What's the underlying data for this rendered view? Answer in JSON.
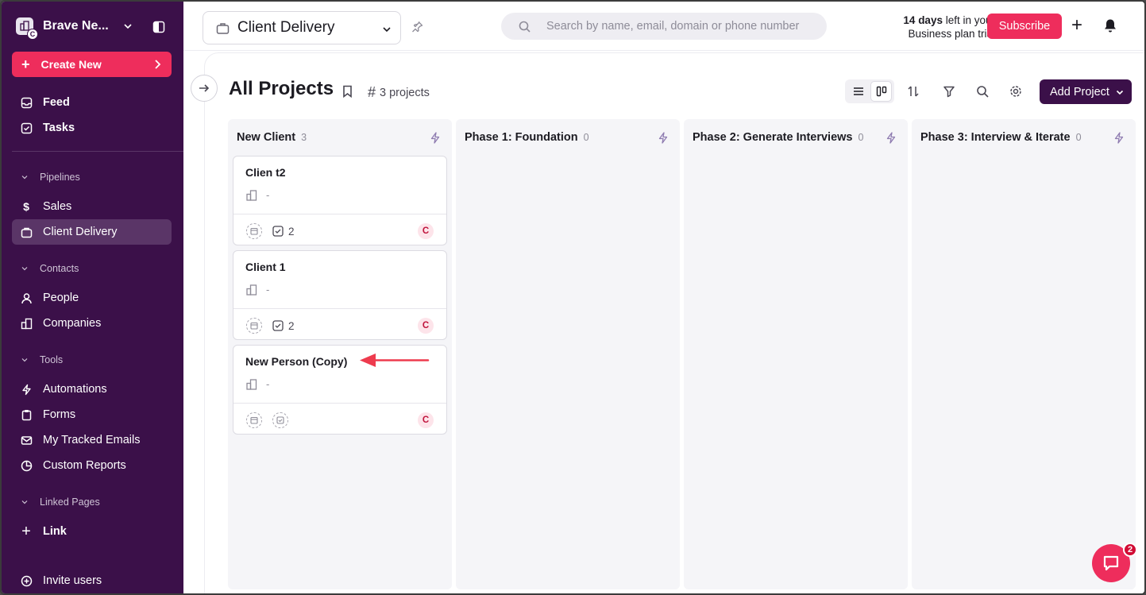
{
  "sidebar": {
    "workspace_name": "Brave Ne...",
    "workspace_badge": "C",
    "create_label": "Create New",
    "feed": "Feed",
    "tasks": "Tasks",
    "pipelines_label": "Pipelines",
    "sales": "Sales",
    "client_delivery": "Client Delivery",
    "contacts_label": "Contacts",
    "people": "People",
    "companies": "Companies",
    "tools_label": "Tools",
    "automations": "Automations",
    "forms": "Forms",
    "tracked_emails": "My Tracked Emails",
    "custom_reports": "Custom Reports",
    "linked_pages_label": "Linked Pages",
    "link": "Link",
    "invite": "Invite users"
  },
  "topbar": {
    "pipeline": "Client Delivery",
    "search_placeholder": "Search by name, email, domain or phone number",
    "trial_days": "14 days",
    "trial_rest": " left in your",
    "trial_line2": "Business plan trial",
    "subscribe": "Subscribe"
  },
  "page": {
    "title": "All Projects",
    "count": "3 projects",
    "add_project": "Add Project"
  },
  "columns": [
    {
      "name": "New Client",
      "count": "3"
    },
    {
      "name": "Phase 1: Foundation",
      "count": "0"
    },
    {
      "name": "Phase 2: Generate Interviews",
      "count": "0"
    },
    {
      "name": "Phase 3: Interview & Iterate",
      "count": "0"
    }
  ],
  "cards": [
    {
      "title": "Clien t2",
      "company": "-",
      "tasks": "2",
      "owner": "C"
    },
    {
      "title": "Client 1",
      "company": "-",
      "tasks": "2",
      "owner": "C"
    },
    {
      "title": "New Person (Copy)",
      "company": "-",
      "tasks": "",
      "owner": "C"
    }
  ],
  "help": {
    "badge": "2"
  },
  "colors": {
    "sidebar": "#3b1049",
    "accent": "#ee2d5c",
    "annotation_arrow": "#ee3b4e"
  }
}
